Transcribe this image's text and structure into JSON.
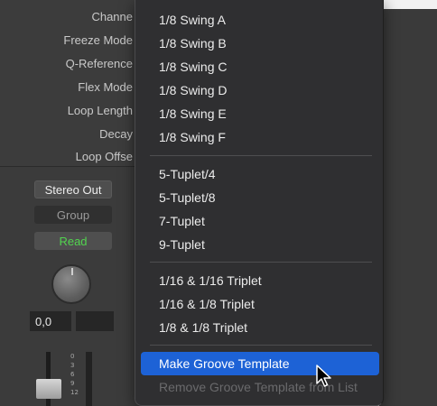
{
  "inspector": {
    "rows": [
      {
        "name": "region-param-channel",
        "label": "Channe"
      },
      {
        "name": "region-param-freeze-mode",
        "label": "Freeze Mode"
      },
      {
        "name": "region-param-q-reference",
        "label": "Q-Reference"
      },
      {
        "name": "region-param-flex-mode",
        "label": "Flex Mode"
      },
      {
        "name": "region-param-loop-length",
        "label": "Loop Length"
      },
      {
        "name": "region-param-decay",
        "label": "Decay"
      },
      {
        "name": "region-param-loop-offset",
        "label": "Loop Offse"
      }
    ]
  },
  "channel_strip": {
    "output_label": "Stereo Out",
    "group_label": "Group",
    "automation_label": "Read",
    "automation_color": "#52d44f",
    "pan_value": "0,0",
    "meter_ticks": [
      "0",
      "3",
      "6",
      "9",
      "12"
    ]
  },
  "menu": {
    "groups": [
      [
        "1/8 Swing A",
        "1/8 Swing B",
        "1/8 Swing C",
        "1/8 Swing D",
        "1/8 Swing E",
        "1/8 Swing F"
      ],
      [
        "5-Tuplet/4",
        "5-Tuplet/8",
        "7-Tuplet",
        "9-Tuplet"
      ],
      [
        "1/16 & 1/16 Triplet",
        "1/16 & 1/8 Triplet",
        "1/8 & 1/8 Triplet"
      ]
    ],
    "make_groove_template": "Make Groove Template",
    "remove_groove_template": "Remove Groove Template from List",
    "highlight_color": "#1d62d6"
  }
}
